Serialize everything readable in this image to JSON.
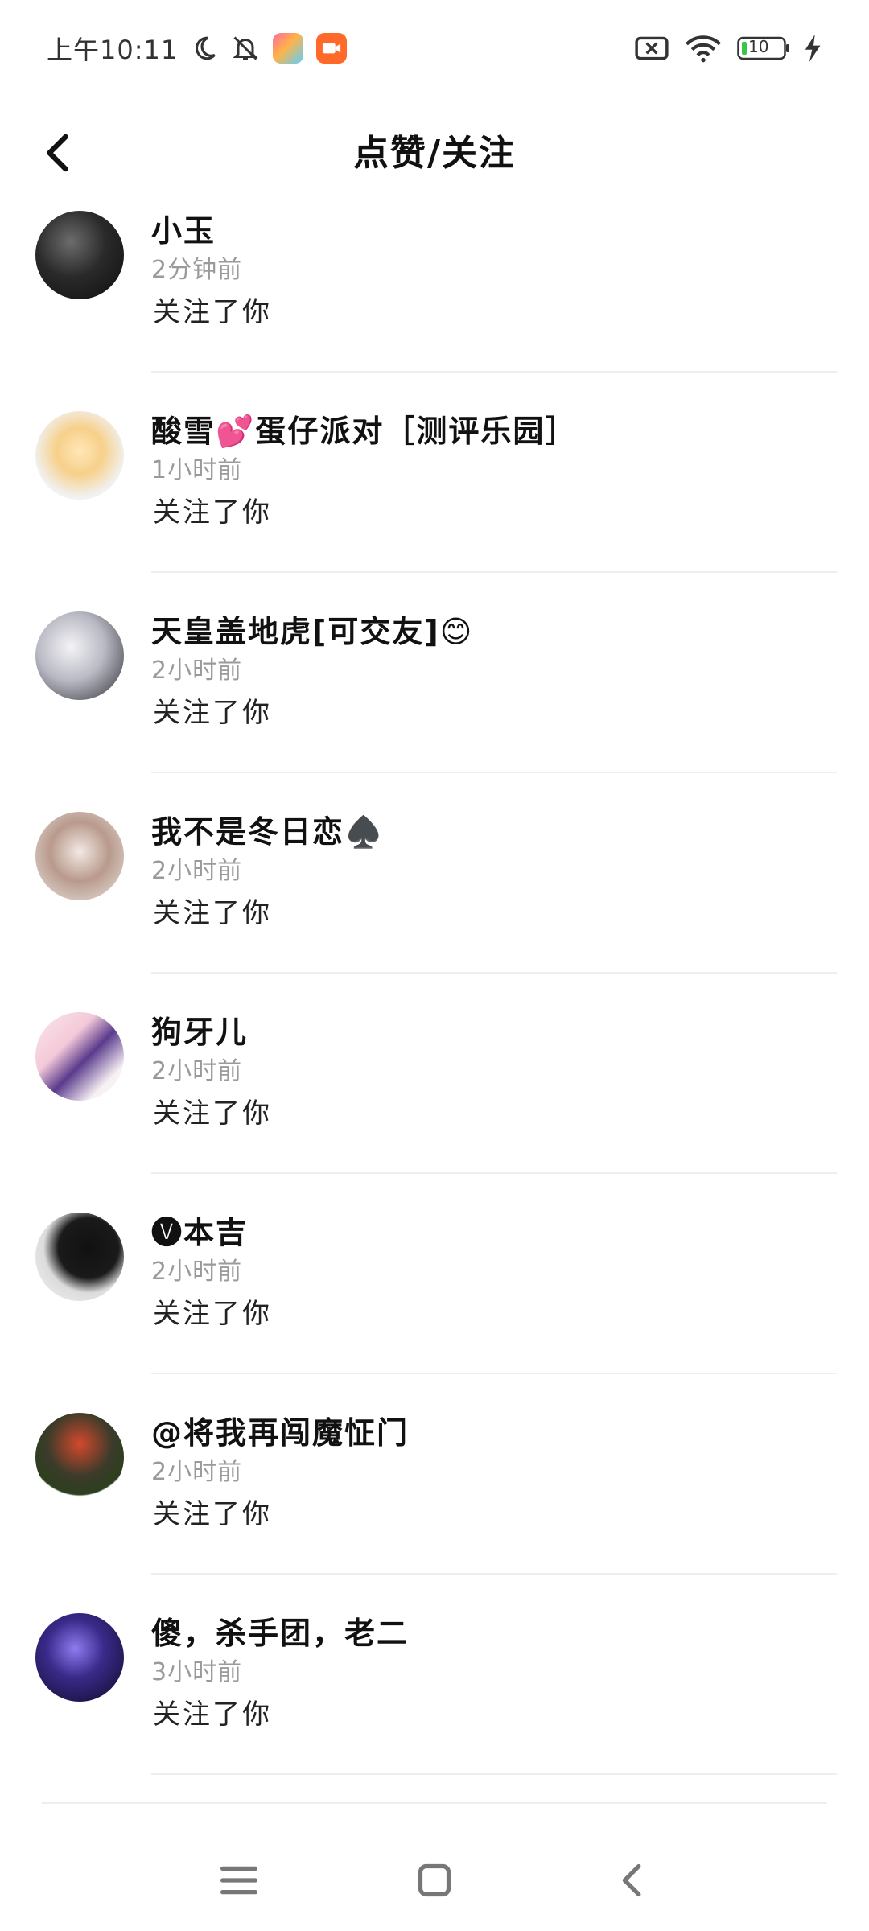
{
  "status_bar": {
    "time": "上午10:11",
    "battery": "10"
  },
  "header": {
    "title": "点赞/关注"
  },
  "notifications": [
    {
      "name": "小玉",
      "time": "2分钟前",
      "action": "关注了你"
    },
    {
      "name": "酸雪💕蛋仔派对［测评乐园］",
      "time": "1小时前",
      "action": "关注了你"
    },
    {
      "name": "天皇盖地虎[可交友]😊",
      "time": "2小时前",
      "action": "关注了你"
    },
    {
      "name": "我不是冬日恋♠️",
      "time": "2小时前",
      "action": "关注了你"
    },
    {
      "name": "狗牙儿",
      "time": "2小时前",
      "action": "关注了你"
    },
    {
      "name": "🅥本吉",
      "time": "2小时前",
      "action": "关注了你"
    },
    {
      "name": "@将我再闯魔怔门",
      "time": "2小时前",
      "action": "关注了你"
    },
    {
      "name": "傻，杀手团，老二",
      "time": "3小时前",
      "action": "关注了你"
    }
  ],
  "colors": {
    "accent": "#111111",
    "secondary_text": "#9a9a9a",
    "divider": "#eeeeee"
  }
}
